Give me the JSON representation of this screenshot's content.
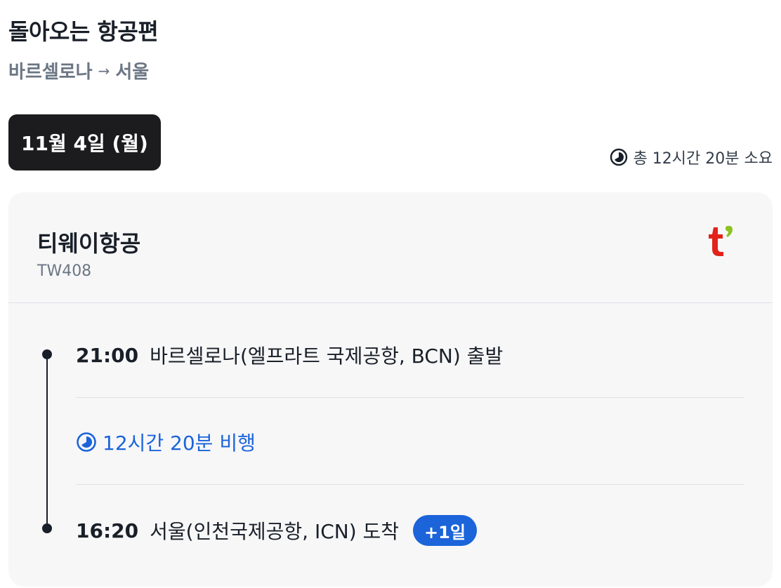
{
  "header": {
    "title": "돌아오는 항공편",
    "route_from": "바르셀로나",
    "route_arrow": "→",
    "route_to": "서울"
  },
  "date_chip": "11월 4일 (월)",
  "total_duration": "총 12시간 20분 소요",
  "flight": {
    "airline": "티웨이항공",
    "flight_number": "TW408",
    "logo_icon": "tway-logo-icon",
    "departure": {
      "time": "21:00",
      "place": "바르셀로나(엘프라트 국제공항, BCN) 출발"
    },
    "duration": "12시간 20분 비행",
    "arrival": {
      "time": "16:20",
      "place": "서울(인천국제공항, ICN) 도착",
      "day_offset": "+1일"
    }
  },
  "colors": {
    "accent": "#1b64da",
    "chip_bg": "#1c1c1e",
    "card_bg": "#f7f7f8",
    "logo_red": "#e2231a",
    "logo_green": "#8dc21f"
  }
}
